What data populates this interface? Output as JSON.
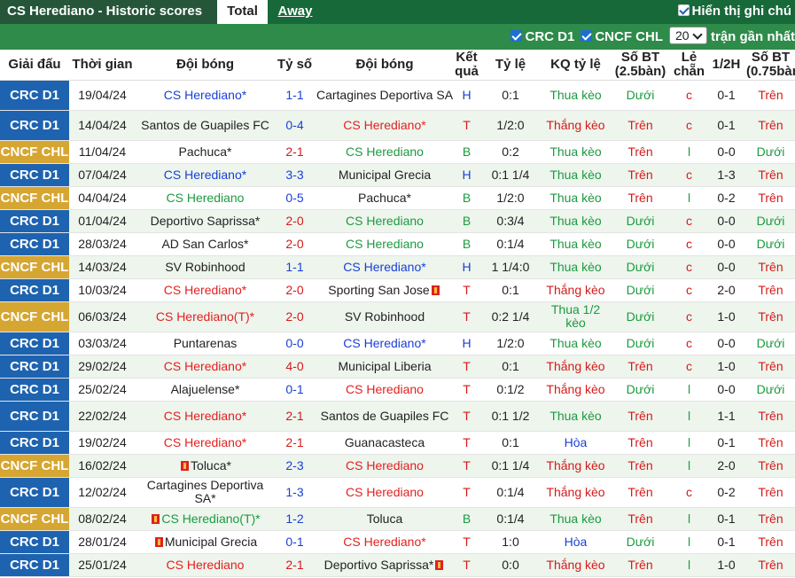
{
  "header": {
    "title": "CS Herediano - Historic scores",
    "tabs": [
      "Total",
      "Away"
    ],
    "show_text": "Hiển thị ghi chú"
  },
  "filters": {
    "league1": "CRC D1",
    "league2": "CNCF CHL",
    "count": "20",
    "recent_label": "trận gần nhất"
  },
  "columns": [
    "Giải đấu",
    "Thời gian",
    "Đội bóng",
    "Tỷ số",
    "Đội bóng",
    "Kết quả",
    "Tỷ lệ",
    "KQ tỷ lệ",
    "Số BT (2.5bàn)",
    "Lẻ chẵn",
    "1/2H",
    "Số BT (0.75bàn)"
  ],
  "colors": {
    "crc": "#1e63b0",
    "cncf": "#d6a632",
    "topbar": "#17693a",
    "filterbar": "#2e8b4a"
  },
  "matches": [
    {
      "league": "CRC D1",
      "lt": "crc",
      "date": "19/04/24",
      "home": "CS Herediano*",
      "hc": "hb",
      "score": "1-1",
      "sc": "sblue",
      "away": "Cartagines Deportiva SA",
      "ac": "",
      "res": "H",
      "odds": "0:1",
      "kq": "Thua kèo",
      "kc": "kThua",
      "bt": "Dưới",
      "btc": "bDuoi",
      "lc": "c",
      "lcc": "lc",
      "half": "0-1",
      "bt2": "Trên",
      "bt2c": "bTren"
    },
    {
      "league": "CRC D1",
      "lt": "crc",
      "date": "14/04/24",
      "home": "Santos de Guapiles FC",
      "hc": "",
      "score": "0-4",
      "sc": "sblue",
      "away": "CS Herediano*",
      "ac": "hr",
      "res": "T",
      "odds": "1/2:0",
      "kq": "Thắng kèo",
      "kc": "kThang",
      "bt": "Trên",
      "btc": "bTren",
      "lc": "c",
      "lcc": "lc",
      "half": "0-1",
      "bt2": "Trên",
      "bt2c": "bTren"
    },
    {
      "league": "CNCF CHL",
      "lt": "cncf",
      "date": "11/04/24",
      "home": "Pachuca*",
      "hc": "",
      "score": "2-1",
      "sc": "sred",
      "away": "CS Herediano",
      "ac": "hg",
      "res": "B",
      "odds": "0:2",
      "kq": "Thua kèo",
      "kc": "kThua",
      "bt": "Trên",
      "btc": "bTren",
      "lc": "l",
      "lcc": "ll",
      "half": "0-0",
      "bt2": "Dưới",
      "bt2c": "bDuoi"
    },
    {
      "league": "CRC D1",
      "lt": "crc",
      "date": "07/04/24",
      "home": "CS Herediano*",
      "hc": "hb",
      "score": "3-3",
      "sc": "sblue",
      "away": "Municipal Grecia",
      "ac": "",
      "res": "H",
      "odds": "0:1 1/4",
      "kq": "Thua kèo",
      "kc": "kThua",
      "bt": "Trên",
      "btc": "bTren",
      "lc": "c",
      "lcc": "lc",
      "half": "1-3",
      "bt2": "Trên",
      "bt2c": "bTren"
    },
    {
      "league": "CNCF CHL",
      "lt": "cncf",
      "date": "04/04/24",
      "home": "CS Herediano",
      "hc": "hg",
      "score": "0-5",
      "sc": "sblue",
      "away": "Pachuca*",
      "ac": "",
      "res": "B",
      "odds": "1/2:0",
      "kq": "Thua kèo",
      "kc": "kThua",
      "bt": "Trên",
      "btc": "bTren",
      "lc": "l",
      "lcc": "ll",
      "half": "0-2",
      "bt2": "Trên",
      "bt2c": "bTren"
    },
    {
      "league": "CRC D1",
      "lt": "crc",
      "date": "01/04/24",
      "home": "Deportivo Saprissa*",
      "hc": "",
      "score": "2-0",
      "sc": "sred",
      "away": "CS Herediano",
      "ac": "hg",
      "res": "B",
      "odds": "0:3/4",
      "kq": "Thua kèo",
      "kc": "kThua",
      "bt": "Dưới",
      "btc": "bDuoi",
      "lc": "c",
      "lcc": "lc",
      "half": "0-0",
      "bt2": "Dưới",
      "bt2c": "bDuoi"
    },
    {
      "league": "CRC D1",
      "lt": "crc",
      "date": "28/03/24",
      "home": "AD San Carlos*",
      "hc": "",
      "score": "2-0",
      "sc": "sred",
      "away": "CS Herediano",
      "ac": "hg",
      "res": "B",
      "odds": "0:1/4",
      "kq": "Thua kèo",
      "kc": "kThua",
      "bt": "Dưới",
      "btc": "bDuoi",
      "lc": "c",
      "lcc": "lc",
      "half": "0-0",
      "bt2": "Dưới",
      "bt2c": "bDuoi"
    },
    {
      "league": "CNCF CHL",
      "lt": "cncf",
      "date": "14/03/24",
      "home": "SV Robinhood",
      "hc": "",
      "score": "1-1",
      "sc": "sblue",
      "away": "CS Herediano*",
      "ac": "hb",
      "res": "H",
      "odds": "1 1/4:0",
      "kq": "Thua kèo",
      "kc": "kThua",
      "bt": "Dưới",
      "btc": "bDuoi",
      "lc": "c",
      "lcc": "lc",
      "half": "0-0",
      "bt2": "Trên",
      "bt2c": "bTren"
    },
    {
      "league": "CRC D1",
      "lt": "crc",
      "date": "10/03/24",
      "home": "CS Herediano*",
      "hc": "hr",
      "score": "2-0",
      "sc": "sred",
      "away": "Sporting San Jose",
      "ac": "",
      "acard": true,
      "res": "T",
      "odds": "0:1",
      "kq": "Thắng kèo",
      "kc": "kThang",
      "bt": "Dưới",
      "btc": "bDuoi",
      "lc": "c",
      "lcc": "lc",
      "half": "2-0",
      "bt2": "Trên",
      "bt2c": "bTren"
    },
    {
      "league": "CNCF CHL",
      "lt": "cncf",
      "date": "06/03/24",
      "home": "CS Herediano(T)*",
      "hc": "hr",
      "score": "2-0",
      "sc": "sred",
      "away": "SV Robinhood",
      "ac": "",
      "res": "T",
      "odds": "0:2 1/4",
      "kq": "Thua 1/2 kèo",
      "kc": "kThua",
      "bt": "Dưới",
      "btc": "bDuoi",
      "lc": "c",
      "lcc": "lc",
      "half": "1-0",
      "bt2": "Trên",
      "bt2c": "bTren"
    },
    {
      "league": "CRC D1",
      "lt": "crc",
      "date": "03/03/24",
      "home": "Puntarenas",
      "hc": "",
      "score": "0-0",
      "sc": "sblue",
      "away": "CS Herediano*",
      "ac": "hb",
      "res": "H",
      "odds": "1/2:0",
      "kq": "Thua kèo",
      "kc": "kThua",
      "bt": "Dưới",
      "btc": "bDuoi",
      "lc": "c",
      "lcc": "lc",
      "half": "0-0",
      "bt2": "Dưới",
      "bt2c": "bDuoi"
    },
    {
      "league": "CRC D1",
      "lt": "crc",
      "date": "29/02/24",
      "home": "CS Herediano*",
      "hc": "hr",
      "score": "4-0",
      "sc": "sred",
      "away": "Municipal Liberia",
      "ac": "",
      "res": "T",
      "odds": "0:1",
      "kq": "Thắng kèo",
      "kc": "kThang",
      "bt": "Trên",
      "btc": "bTren",
      "lc": "c",
      "lcc": "lc",
      "half": "1-0",
      "bt2": "Trên",
      "bt2c": "bTren"
    },
    {
      "league": "CRC D1",
      "lt": "crc",
      "date": "25/02/24",
      "home": "Alajuelense*",
      "hc": "",
      "score": "0-1",
      "sc": "sblue",
      "away": "CS Herediano",
      "ac": "hr",
      "res": "T",
      "odds": "0:1/2",
      "kq": "Thắng kèo",
      "kc": "kThang",
      "bt": "Dưới",
      "btc": "bDuoi",
      "lc": "l",
      "lcc": "ll",
      "half": "0-0",
      "bt2": "Dưới",
      "bt2c": "bDuoi"
    },
    {
      "league": "CRC D1",
      "lt": "crc",
      "date": "22/02/24",
      "home": "CS Herediano*",
      "hc": "hr",
      "score": "2-1",
      "sc": "sred",
      "away": "Santos de Guapiles FC",
      "ac": "",
      "res": "T",
      "odds": "0:1 1/2",
      "kq": "Thua kèo",
      "kc": "kThua",
      "bt": "Trên",
      "btc": "bTren",
      "lc": "l",
      "lcc": "ll",
      "half": "1-1",
      "bt2": "Trên",
      "bt2c": "bTren"
    },
    {
      "league": "CRC D1",
      "lt": "crc",
      "date": "19/02/24",
      "home": "CS Herediano*",
      "hc": "hr",
      "score": "2-1",
      "sc": "sred",
      "away": "Guanacasteca",
      "ac": "",
      "res": "T",
      "odds": "0:1",
      "kq": "Hòa",
      "kc": "kHoa",
      "bt": "Trên",
      "btc": "bTren",
      "lc": "l",
      "lcc": "ll",
      "half": "0-1",
      "bt2": "Trên",
      "bt2c": "bTren"
    },
    {
      "league": "CNCF CHL",
      "lt": "cncf",
      "date": "16/02/24",
      "home": "Toluca*",
      "hc": "",
      "hcard": true,
      "score": "2-3",
      "sc": "sblue",
      "away": "CS Herediano",
      "ac": "hr",
      "res": "T",
      "odds": "0:1 1/4",
      "kq": "Thắng kèo",
      "kc": "kThang",
      "bt": "Trên",
      "btc": "bTren",
      "lc": "l",
      "lcc": "ll",
      "half": "2-0",
      "bt2": "Trên",
      "bt2c": "bTren"
    },
    {
      "league": "CRC D1",
      "lt": "crc",
      "date": "12/02/24",
      "home": "Cartagines Deportiva SA*",
      "hc": "",
      "score": "1-3",
      "sc": "sblue",
      "away": "CS Herediano",
      "ac": "hr",
      "res": "T",
      "odds": "0:1/4",
      "kq": "Thắng kèo",
      "kc": "kThang",
      "bt": "Trên",
      "btc": "bTren",
      "lc": "c",
      "lcc": "lc",
      "half": "0-2",
      "bt2": "Trên",
      "bt2c": "bTren"
    },
    {
      "league": "CNCF CHL",
      "lt": "cncf",
      "date": "08/02/24",
      "home": "CS Herediano(T)*",
      "hc": "hg",
      "hcard": true,
      "score": "1-2",
      "sc": "sblue",
      "away": "Toluca",
      "ac": "",
      "res": "B",
      "odds": "0:1/4",
      "kq": "Thua kèo",
      "kc": "kThua",
      "bt": "Trên",
      "btc": "bTren",
      "lc": "l",
      "lcc": "ll",
      "half": "0-1",
      "bt2": "Trên",
      "bt2c": "bTren"
    },
    {
      "league": "CRC D1",
      "lt": "crc",
      "date": "28/01/24",
      "home": "Municipal Grecia",
      "hc": "",
      "hcard": true,
      "score": "0-1",
      "sc": "sblue",
      "away": "CS Herediano*",
      "ac": "hr",
      "res": "T",
      "odds": "1:0",
      "kq": "Hòa",
      "kc": "kHoa",
      "bt": "Dưới",
      "btc": "bDuoi",
      "lc": "l",
      "lcc": "ll",
      "half": "0-1",
      "bt2": "Trên",
      "bt2c": "bTren"
    },
    {
      "league": "CRC D1",
      "lt": "crc",
      "date": "25/01/24",
      "home": "CS Herediano",
      "hc": "hr",
      "score": "2-1",
      "sc": "sred",
      "away": "Deportivo Saprissa*",
      "ac": "",
      "acard": true,
      "res": "T",
      "odds": "0:0",
      "kq": "Thắng kèo",
      "kc": "kThang",
      "bt": "Trên",
      "btc": "bTren",
      "lc": "l",
      "lcc": "ll",
      "half": "1-0",
      "bt2": "Trên",
      "bt2c": "bTren"
    }
  ]
}
